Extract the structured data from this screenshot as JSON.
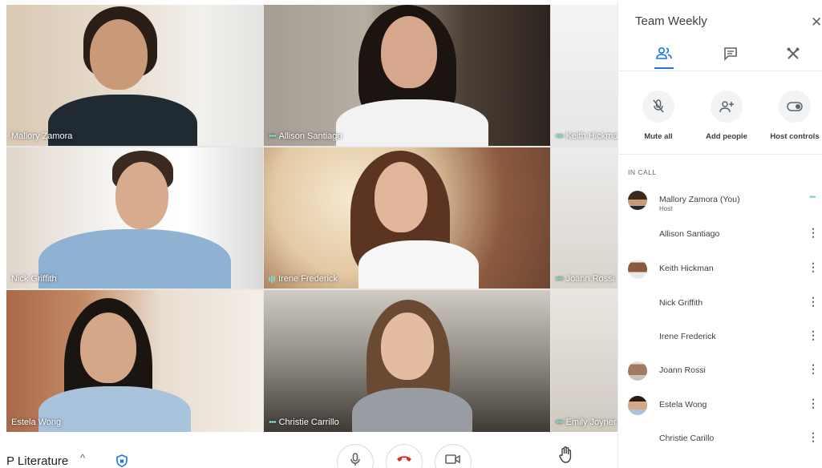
{
  "colors": {
    "accent": "#1a73e8",
    "end_call": "#d93025",
    "speaking": "#7fd6c4"
  },
  "tiles": [
    {
      "name": "Mallory Zamora",
      "indicator": "none"
    },
    {
      "name": "Allison Santiago",
      "indicator": "dots"
    },
    {
      "name": "Keith Hickman",
      "indicator": "dots"
    },
    {
      "name": "Nick Griffith",
      "indicator": "none"
    },
    {
      "name": "Irene Frederick",
      "indicator": "bars"
    },
    {
      "name": "Joann Rossi",
      "indicator": "dots"
    },
    {
      "name": "Estela Wong",
      "indicator": "none"
    },
    {
      "name": "Christie Carrillo",
      "indicator": "dots"
    },
    {
      "name": "Emily Joyner",
      "indicator": "dots"
    }
  ],
  "bottom": {
    "meeting_title": "P Literature",
    "chevron_icon": "chevron-up-icon",
    "shield_icon": "shield-icon",
    "controls": [
      "mic-icon",
      "end-call-icon",
      "camera-icon"
    ],
    "hand_icon": "raise-hand-icon"
  },
  "panel": {
    "title": "Team Weekly",
    "close_icon": "close-icon",
    "tabs": [
      {
        "icon": "people-icon",
        "selected": true
      },
      {
        "icon": "chat-icon",
        "selected": false
      },
      {
        "icon": "activities-icon",
        "selected": false
      }
    ],
    "actions": [
      {
        "label": "Mute all",
        "icon": "mic-off-icon"
      },
      {
        "label": "Add people",
        "icon": "person-add-icon"
      },
      {
        "label": "Host controls",
        "icon": "toggle-icon"
      }
    ],
    "section_label": "IN CALL",
    "participants": [
      {
        "name": "Mallory Zamora (You)",
        "subtitle": "Host",
        "avatar": true,
        "speaking": true
      },
      {
        "name": "Allison Santiago",
        "subtitle": "",
        "avatar": false,
        "speaking": false
      },
      {
        "name": "Keith Hickman",
        "subtitle": "",
        "avatar": true,
        "speaking": false
      },
      {
        "name": "Nick Griffith",
        "subtitle": "",
        "avatar": false,
        "speaking": false
      },
      {
        "name": "Irene Frederick",
        "subtitle": "",
        "avatar": false,
        "speaking": false
      },
      {
        "name": "Joann Rossi",
        "subtitle": "",
        "avatar": true,
        "speaking": false
      },
      {
        "name": "Estela Wong",
        "subtitle": "",
        "avatar": true,
        "speaking": false
      },
      {
        "name": "Christie Carillo",
        "subtitle": "",
        "avatar": false,
        "speaking": false
      }
    ]
  }
}
